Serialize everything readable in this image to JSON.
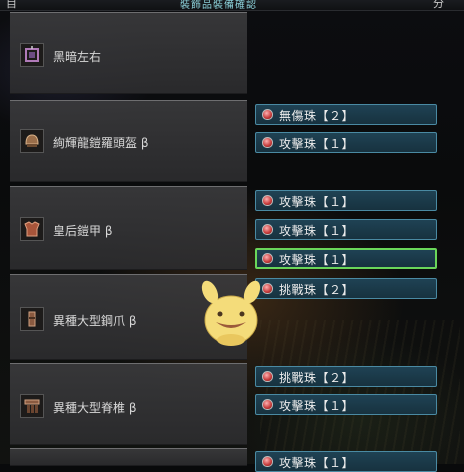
{
  "header": {
    "title": "裝飾品裝備確認",
    "left_glyph": "目",
    "right_glyph": "分"
  },
  "equipment": [
    {
      "name": "黑暗左右",
      "icon": "charm-icon",
      "decorations": []
    },
    {
      "name": "絢輝龍鎧羅頭盔 β",
      "icon": "helm-icon",
      "decorations": [
        {
          "label": "無傷珠【２】"
        },
        {
          "label": "攻擊珠【１】"
        }
      ]
    },
    {
      "name": "皇后鎧甲 β",
      "icon": "chest-icon",
      "decorations": [
        {
          "label": "攻擊珠【１】"
        },
        {
          "label": "攻擊珠【１】"
        },
        {
          "label": "攻擊珠【１】",
          "selected": true
        }
      ]
    },
    {
      "name": "異種大型鋼爪 β",
      "icon": "arms-icon",
      "decorations": [
        {
          "label": "挑戰珠【２】"
        }
      ]
    },
    {
      "name": "異種大型脊椎 β",
      "icon": "waist-icon",
      "decorations": [
        {
          "label": "挑戰珠【２】"
        },
        {
          "label": "攻擊珠【１】"
        }
      ]
    },
    {
      "name": "",
      "icon": "legs-icon",
      "decorations": [
        {
          "label": "攻擊珠【１】"
        }
      ]
    }
  ],
  "colors": {
    "slot_border": "#4a8aa3",
    "selected_border": "#6ad65a",
    "gem": "#c53a3a"
  }
}
